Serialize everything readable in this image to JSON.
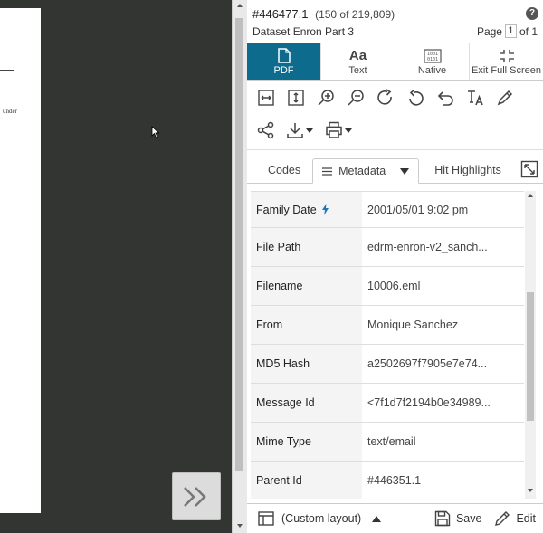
{
  "viewer": {
    "doc_snippet": "under",
    "expand_icon": "double-chevron-right-icon"
  },
  "header": {
    "doc_id": "#446477.1",
    "doc_count": "(150 of 219,809)",
    "dataset": "Dataset Enron Part 3",
    "page_label": "Page",
    "page_value": "1",
    "page_total": "of 1"
  },
  "view_tabs": [
    {
      "label": "PDF",
      "icon": "pdf-file-icon",
      "active": true
    },
    {
      "label": "Text",
      "icon": "text-aa-icon",
      "glyph": "Aa"
    },
    {
      "label": "Native",
      "icon": "binary-file-icon"
    },
    {
      "label": "Exit Full Screen",
      "icon": "exit-fullscreen-icon"
    }
  ],
  "toolbar": {
    "row1": [
      "fit-width-icon",
      "fit-height-icon",
      "zoom-in-icon",
      "zoom-out-icon",
      "rotate-clockwise-icon",
      "rotate-counterclockwise-icon",
      "undo-icon",
      "text-size-icon",
      "annotate-icon"
    ],
    "row2": [
      "share-icon",
      "download-icon",
      "print-icon"
    ]
  },
  "panel_tabs": {
    "codes": "Codes",
    "metadata": "Metadata",
    "hit_highlights": "Hit Highlights"
  },
  "metadata": [
    {
      "key": "Family Date",
      "value": "2001/05/01 9:02 pm",
      "flag": true
    },
    {
      "key": "File Path",
      "value": "edrm-enron-v2_sanch..."
    },
    {
      "key": "Filename",
      "value": "10006.eml"
    },
    {
      "key": "From",
      "value": "Monique Sanchez"
    },
    {
      "key": "MD5 Hash",
      "value": "a2502697f7905e7e74..."
    },
    {
      "key": "Message Id",
      "value": "<7f1d7f2194b0e34989..."
    },
    {
      "key": "Mime Type",
      "value": "text/email"
    },
    {
      "key": "Parent Id",
      "value": "#446351.1"
    }
  ],
  "footer": {
    "layout_label": "(Custom layout)",
    "save_label": "Save",
    "edit_label": "Edit"
  },
  "colors": {
    "accent": "#0d6b8e",
    "viewer_bg": "#333533",
    "flag": "#1a7ab8"
  }
}
